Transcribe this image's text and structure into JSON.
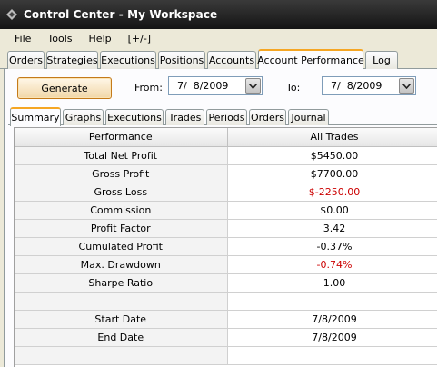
{
  "window": {
    "title": "Control Center - My Workspace"
  },
  "menu": [
    "File",
    "Tools",
    "Help",
    "[+/-]"
  ],
  "top_tabs": [
    "Orders",
    "Strategies",
    "Executions",
    "Positions",
    "Accounts",
    "Account Performance",
    "Log"
  ],
  "active_top_tab": "Account Performance",
  "controls": {
    "generate_label": "Generate",
    "from_label": "From:",
    "from_date": "7/  8/2009",
    "to_label": "To:",
    "to_date": "7/  8/2009"
  },
  "sub_tabs": [
    "Summary",
    "Graphs",
    "Executions",
    "Trades",
    "Periods",
    "Orders",
    "Journal"
  ],
  "active_sub_tab": "Summary",
  "table": {
    "headers": [
      "Performance",
      "All Trades"
    ],
    "rows": [
      {
        "name": "Total Net Profit",
        "value": "$5450.00",
        "negative": false
      },
      {
        "name": "Gross Profit",
        "value": "$7700.00",
        "negative": false
      },
      {
        "name": "Gross Loss",
        "value": "$-2250.00",
        "negative": true
      },
      {
        "name": "Commission",
        "value": "$0.00",
        "negative": false
      },
      {
        "name": "Profit Factor",
        "value": "3.42",
        "negative": false
      },
      {
        "name": "Cumulated Profit",
        "value": "-0.37%",
        "negative": false
      },
      {
        "name": "Max. Drawdown",
        "value": "-0.74%",
        "negative": true
      },
      {
        "name": "Sharpe Ratio",
        "value": "1.00",
        "negative": false
      },
      {
        "name": "",
        "value": "",
        "negative": false
      },
      {
        "name": "Start Date",
        "value": "7/8/2009",
        "negative": false
      },
      {
        "name": "End Date",
        "value": "7/8/2009",
        "negative": false
      },
      {
        "name": "",
        "value": "",
        "negative": false
      }
    ]
  },
  "colors": {
    "negative": "#cc0000",
    "active_tab_accent": "#f5a623",
    "titlebar": "#1e1e1e"
  }
}
